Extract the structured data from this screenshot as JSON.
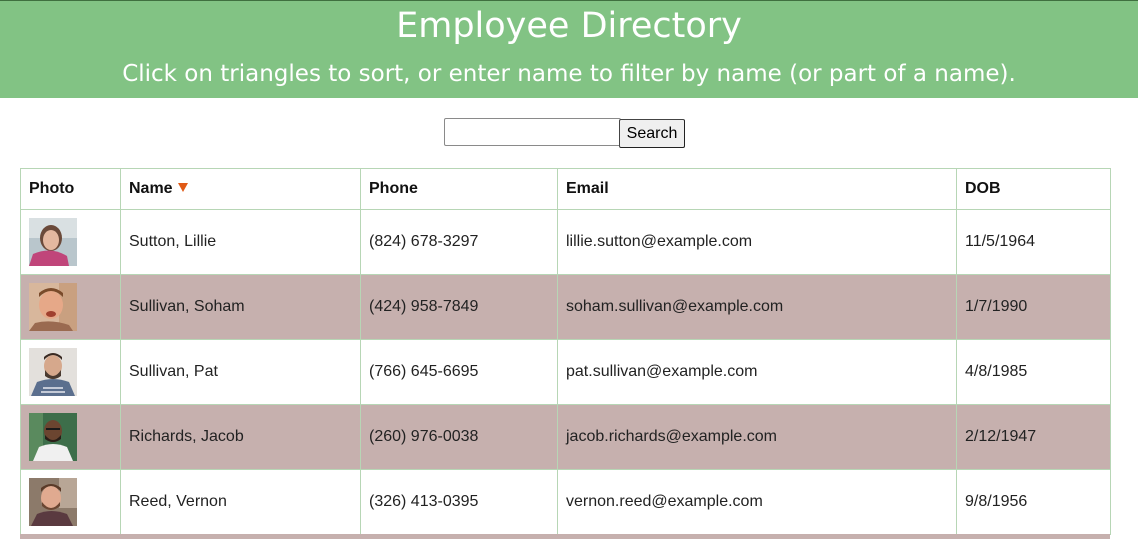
{
  "header": {
    "title": "Employee Directory",
    "subtitle": "Click on triangles to sort, or enter name to filter by name (or part of a name)."
  },
  "search": {
    "value": "",
    "placeholder": "",
    "button_label": "Search"
  },
  "table": {
    "columns": {
      "photo": "Photo",
      "name": "Name",
      "phone": "Phone",
      "email": "Email",
      "dob": "DOB"
    },
    "sort": {
      "column": "Name",
      "direction": "descending",
      "icon": "triangle-down-icon",
      "color": "#e05a16"
    },
    "rows": [
      {
        "photo_icon": "employee-photo",
        "name": "Sutton, Lillie",
        "phone": "(824) 678-3297",
        "email": "lillie.sutton@example.com",
        "dob": "11/5/1964"
      },
      {
        "photo_icon": "employee-photo",
        "name": "Sullivan, Soham",
        "phone": "(424) 958-7849",
        "email": "soham.sullivan@example.com",
        "dob": "1/7/1990"
      },
      {
        "photo_icon": "employee-photo",
        "name": "Sullivan, Pat",
        "phone": "(766) 645-6695",
        "email": "pat.sullivan@example.com",
        "dob": "4/8/1985"
      },
      {
        "photo_icon": "employee-photo",
        "name": "Richards, Jacob",
        "phone": "(260) 976-0038",
        "email": "jacob.richards@example.com",
        "dob": "2/12/1947"
      },
      {
        "photo_icon": "employee-photo",
        "name": "Reed, Vernon",
        "phone": "(326) 413-0395",
        "email": "vernon.reed@example.com",
        "dob": "9/8/1956"
      }
    ]
  },
  "colors": {
    "header_bg": "#82c384",
    "header_text": "#ffffff",
    "alt_row_bg": "#c6b0ae",
    "grid_border": "#b7d6b5"
  }
}
